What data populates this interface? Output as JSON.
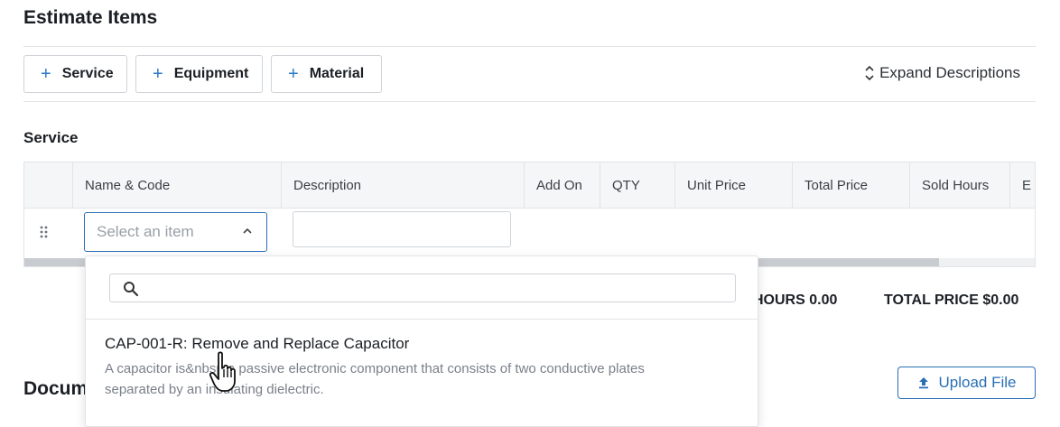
{
  "page": {
    "title": "Estimate Items"
  },
  "add_buttons": [
    {
      "label": "Service",
      "icon": "plus-icon"
    },
    {
      "label": "Equipment",
      "icon": "plus-icon"
    },
    {
      "label": "Material",
      "icon": "plus-icon"
    }
  ],
  "expand_descriptions": {
    "label": "Expand Descriptions",
    "icon": "sort-chevrons-icon"
  },
  "section": {
    "label": "Service",
    "columns": [
      "Name & Code",
      "Description",
      "Add On",
      "QTY",
      "Unit Price",
      "Total Price",
      "Sold Hours",
      "E"
    ],
    "row": {
      "select_placeholder": "Select an item",
      "description_value": ""
    }
  },
  "summary": {
    "sold_hours_text": "HOURS 0.00",
    "total_price_text": "TOTAL PRICE $0.00"
  },
  "dropdown": {
    "search_value": "",
    "options": [
      {
        "title": "CAP-001-R: Remove and Replace Capacitor",
        "description": "A capacitor is&nbsp;a passive electronic component that consists of two conductive plates separated by an insulating dielectric."
      }
    ]
  },
  "documents": {
    "title": "Docum"
  },
  "upload": {
    "label": "Upload File",
    "icon": "upload-icon"
  },
  "colors": {
    "accent": "#2a6fb5",
    "plus": "#2a78c8",
    "border": "#e2e4e7"
  }
}
